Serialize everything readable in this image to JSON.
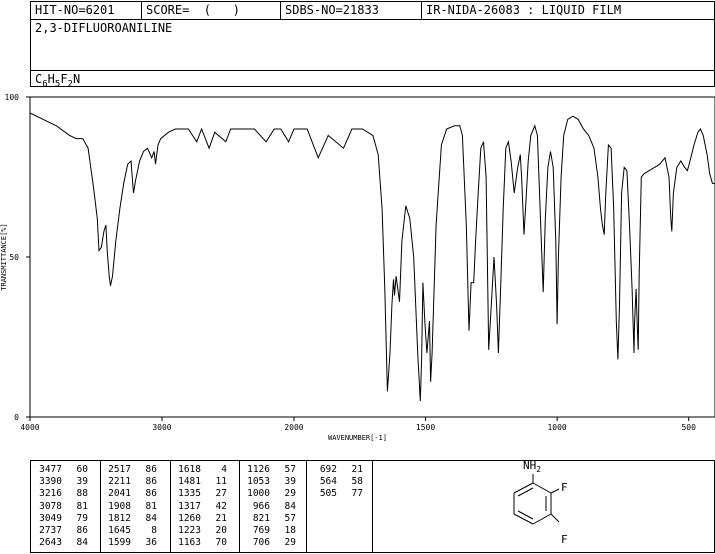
{
  "header": {
    "hit_no": "HIT-NO=6201",
    "score": "SCORE=  (   )",
    "sdbs_no": "SDBS-NO=21833",
    "ir_id": "IR-NIDA-26083 : LIQUID FILM",
    "compound_name": "2,3-DIFLUOROANILINE",
    "formula": "C6H5F2N",
    "formula_parts": {
      "c": "C",
      "c_sub": "6",
      "h": "H",
      "h_sub": "5",
      "f": "F",
      "f_sub": "2",
      "n": "N"
    }
  },
  "structure": {
    "nh2_label": "NH2",
    "nh2_parts": {
      "n": "NH",
      "sub": "2"
    },
    "f_label_top": "F",
    "f_label_bottom": "F"
  },
  "chart_data": {
    "type": "line",
    "title": "",
    "xlabel": "WAVENUMBER[-1]",
    "ylabel": "TRANSMITTANCE[%]",
    "xlim": [
      4000,
      400
    ],
    "ylim": [
      0,
      100
    ],
    "x_ticks": [
      "4000",
      "3000",
      "2000",
      "1500",
      "1000",
      "500"
    ],
    "y_ticks": [
      "100",
      "50",
      "0"
    ],
    "series": [
      {
        "points": [
          [
            4000,
            95
          ],
          [
            3900,
            93
          ],
          [
            3800,
            91
          ],
          [
            3700,
            88
          ],
          [
            3650,
            87
          ],
          [
            3600,
            87
          ],
          [
            3560,
            84
          ],
          [
            3520,
            72
          ],
          [
            3490,
            62
          ],
          [
            3477,
            52
          ],
          [
            3460,
            53
          ],
          [
            3440,
            58
          ],
          [
            3425,
            60
          ],
          [
            3415,
            52
          ],
          [
            3400,
            44
          ],
          [
            3390,
            41
          ],
          [
            3375,
            44
          ],
          [
            3350,
            55
          ],
          [
            3320,
            65
          ],
          [
            3290,
            73
          ],
          [
            3260,
            79
          ],
          [
            3235,
            80
          ],
          [
            3216,
            70
          ],
          [
            3200,
            74
          ],
          [
            3170,
            80
          ],
          [
            3140,
            83
          ],
          [
            3110,
            84
          ],
          [
            3078,
            81
          ],
          [
            3060,
            83
          ],
          [
            3049,
            79
          ],
          [
            3030,
            85
          ],
          [
            3010,
            87
          ],
          [
            2950,
            89
          ],
          [
            2900,
            90
          ],
          [
            2800,
            90
          ],
          [
            2737,
            86
          ],
          [
            2700,
            90
          ],
          [
            2643,
            84
          ],
          [
            2600,
            89
          ],
          [
            2517,
            86
          ],
          [
            2480,
            90
          ],
          [
            2400,
            90
          ],
          [
            2300,
            90
          ],
          [
            2211,
            86
          ],
          [
            2150,
            90
          ],
          [
            2100,
            90
          ],
          [
            2041,
            86
          ],
          [
            2000,
            90
          ],
          [
            1950,
            90
          ],
          [
            1908,
            81
          ],
          [
            1870,
            88
          ],
          [
            1812,
            84
          ],
          [
            1780,
            90
          ],
          [
            1740,
            90
          ],
          [
            1700,
            88
          ],
          [
            1680,
            82
          ],
          [
            1665,
            65
          ],
          [
            1655,
            40
          ],
          [
            1645,
            8
          ],
          [
            1635,
            20
          ],
          [
            1628,
            35
          ],
          [
            1622,
            43
          ],
          [
            1618,
            38
          ],
          [
            1612,
            44
          ],
          [
            1599,
            36
          ],
          [
            1590,
            55
          ],
          [
            1575,
            66
          ],
          [
            1560,
            62
          ],
          [
            1545,
            50
          ],
          [
            1530,
            20
          ],
          [
            1520,
            5
          ],
          [
            1515,
            18
          ],
          [
            1510,
            42
          ],
          [
            1503,
            30
          ],
          [
            1495,
            20
          ],
          [
            1490,
            25
          ],
          [
            1485,
            30
          ],
          [
            1481,
            11
          ],
          [
            1475,
            20
          ],
          [
            1460,
            60
          ],
          [
            1440,
            85
          ],
          [
            1420,
            90
          ],
          [
            1390,
            91
          ],
          [
            1370,
            91
          ],
          [
            1360,
            88
          ],
          [
            1345,
            60
          ],
          [
            1335,
            27
          ],
          [
            1327,
            42
          ],
          [
            1317,
            42
          ],
          [
            1310,
            55
          ],
          [
            1300,
            70
          ],
          [
            1290,
            84
          ],
          [
            1280,
            86
          ],
          [
            1270,
            75
          ],
          [
            1260,
            21
          ],
          [
            1250,
            35
          ],
          [
            1240,
            50
          ],
          [
            1230,
            35
          ],
          [
            1223,
            20
          ],
          [
            1215,
            40
          ],
          [
            1205,
            65
          ],
          [
            1195,
            84
          ],
          [
            1185,
            86
          ],
          [
            1175,
            80
          ],
          [
            1163,
            70
          ],
          [
            1150,
            78
          ],
          [
            1140,
            82
          ],
          [
            1135,
            75
          ],
          [
            1126,
            57
          ],
          [
            1120,
            65
          ],
          [
            1110,
            80
          ],
          [
            1100,
            88
          ],
          [
            1085,
            91
          ],
          [
            1075,
            88
          ],
          [
            1060,
            55
          ],
          [
            1053,
            39
          ],
          [
            1045,
            62
          ],
          [
            1035,
            78
          ],
          [
            1025,
            83
          ],
          [
            1015,
            78
          ],
          [
            1005,
            55
          ],
          [
            1000,
            29
          ],
          [
            995,
            50
          ],
          [
            985,
            75
          ],
          [
            975,
            88
          ],
          [
            960,
            93
          ],
          [
            940,
            94
          ],
          [
            920,
            93
          ],
          [
            900,
            90
          ],
          [
            880,
            88
          ],
          [
            860,
            84
          ],
          [
            845,
            75
          ],
          [
            835,
            65
          ],
          [
            828,
            60
          ],
          [
            821,
            57
          ],
          [
            815,
            70
          ],
          [
            805,
            85
          ],
          [
            795,
            84
          ],
          [
            785,
            65
          ],
          [
            775,
            30
          ],
          [
            769,
            18
          ],
          [
            763,
            35
          ],
          [
            755,
            70
          ],
          [
            745,
            78
          ],
          [
            735,
            77
          ],
          [
            725,
            60
          ],
          [
            715,
            40
          ],
          [
            708,
            20
          ],
          [
            706,
            29
          ],
          [
            700,
            40
          ],
          [
            696,
            30
          ],
          [
            692,
            21
          ],
          [
            688,
            45
          ],
          [
            680,
            75
          ],
          [
            670,
            76
          ],
          [
            650,
            77
          ],
          [
            630,
            78
          ],
          [
            610,
            79
          ],
          [
            590,
            81
          ],
          [
            575,
            75
          ],
          [
            568,
            62
          ],
          [
            564,
            58
          ],
          [
            558,
            70
          ],
          [
            545,
            78
          ],
          [
            530,
            80
          ],
          [
            515,
            78
          ],
          [
            505,
            77
          ],
          [
            495,
            80
          ],
          [
            480,
            85
          ],
          [
            465,
            89
          ],
          [
            455,
            90
          ],
          [
            445,
            88
          ],
          [
            430,
            82
          ],
          [
            420,
            76
          ],
          [
            410,
            73
          ],
          [
            400,
            73
          ]
        ]
      }
    ]
  },
  "peak_table": {
    "columns": [
      [
        [
          "3477",
          "60"
        ],
        [
          "3390",
          "39"
        ],
        [
          "3216",
          "88"
        ],
        [
          "3078",
          "81"
        ],
        [
          "3049",
          "79"
        ],
        [
          "2737",
          "86"
        ],
        [
          "2643",
          "84"
        ]
      ],
      [
        [
          "2517",
          "86"
        ],
        [
          "2211",
          "86"
        ],
        [
          "2041",
          "86"
        ],
        [
          "1908",
          "81"
        ],
        [
          "1812",
          "84"
        ],
        [
          "1645",
          "8"
        ],
        [
          "1599",
          "36"
        ]
      ],
      [
        [
          "1618",
          "4"
        ],
        [
          "1481",
          "11"
        ],
        [
          "1335",
          "27"
        ],
        [
          "1317",
          "42"
        ],
        [
          "1260",
          "21"
        ],
        [
          "1223",
          "20"
        ],
        [
          "1163",
          "70"
        ]
      ],
      [
        [
          "1126",
          "57"
        ],
        [
          "1053",
          "39"
        ],
        [
          "1000",
          "29"
        ],
        [
          "966",
          "84"
        ],
        [
          "821",
          "57"
        ],
        [
          "769",
          "18"
        ],
        [
          "706",
          "29"
        ]
      ],
      [
        [
          "692",
          "21"
        ],
        [
          "564",
          "58"
        ],
        [
          "505",
          "77"
        ]
      ]
    ]
  }
}
